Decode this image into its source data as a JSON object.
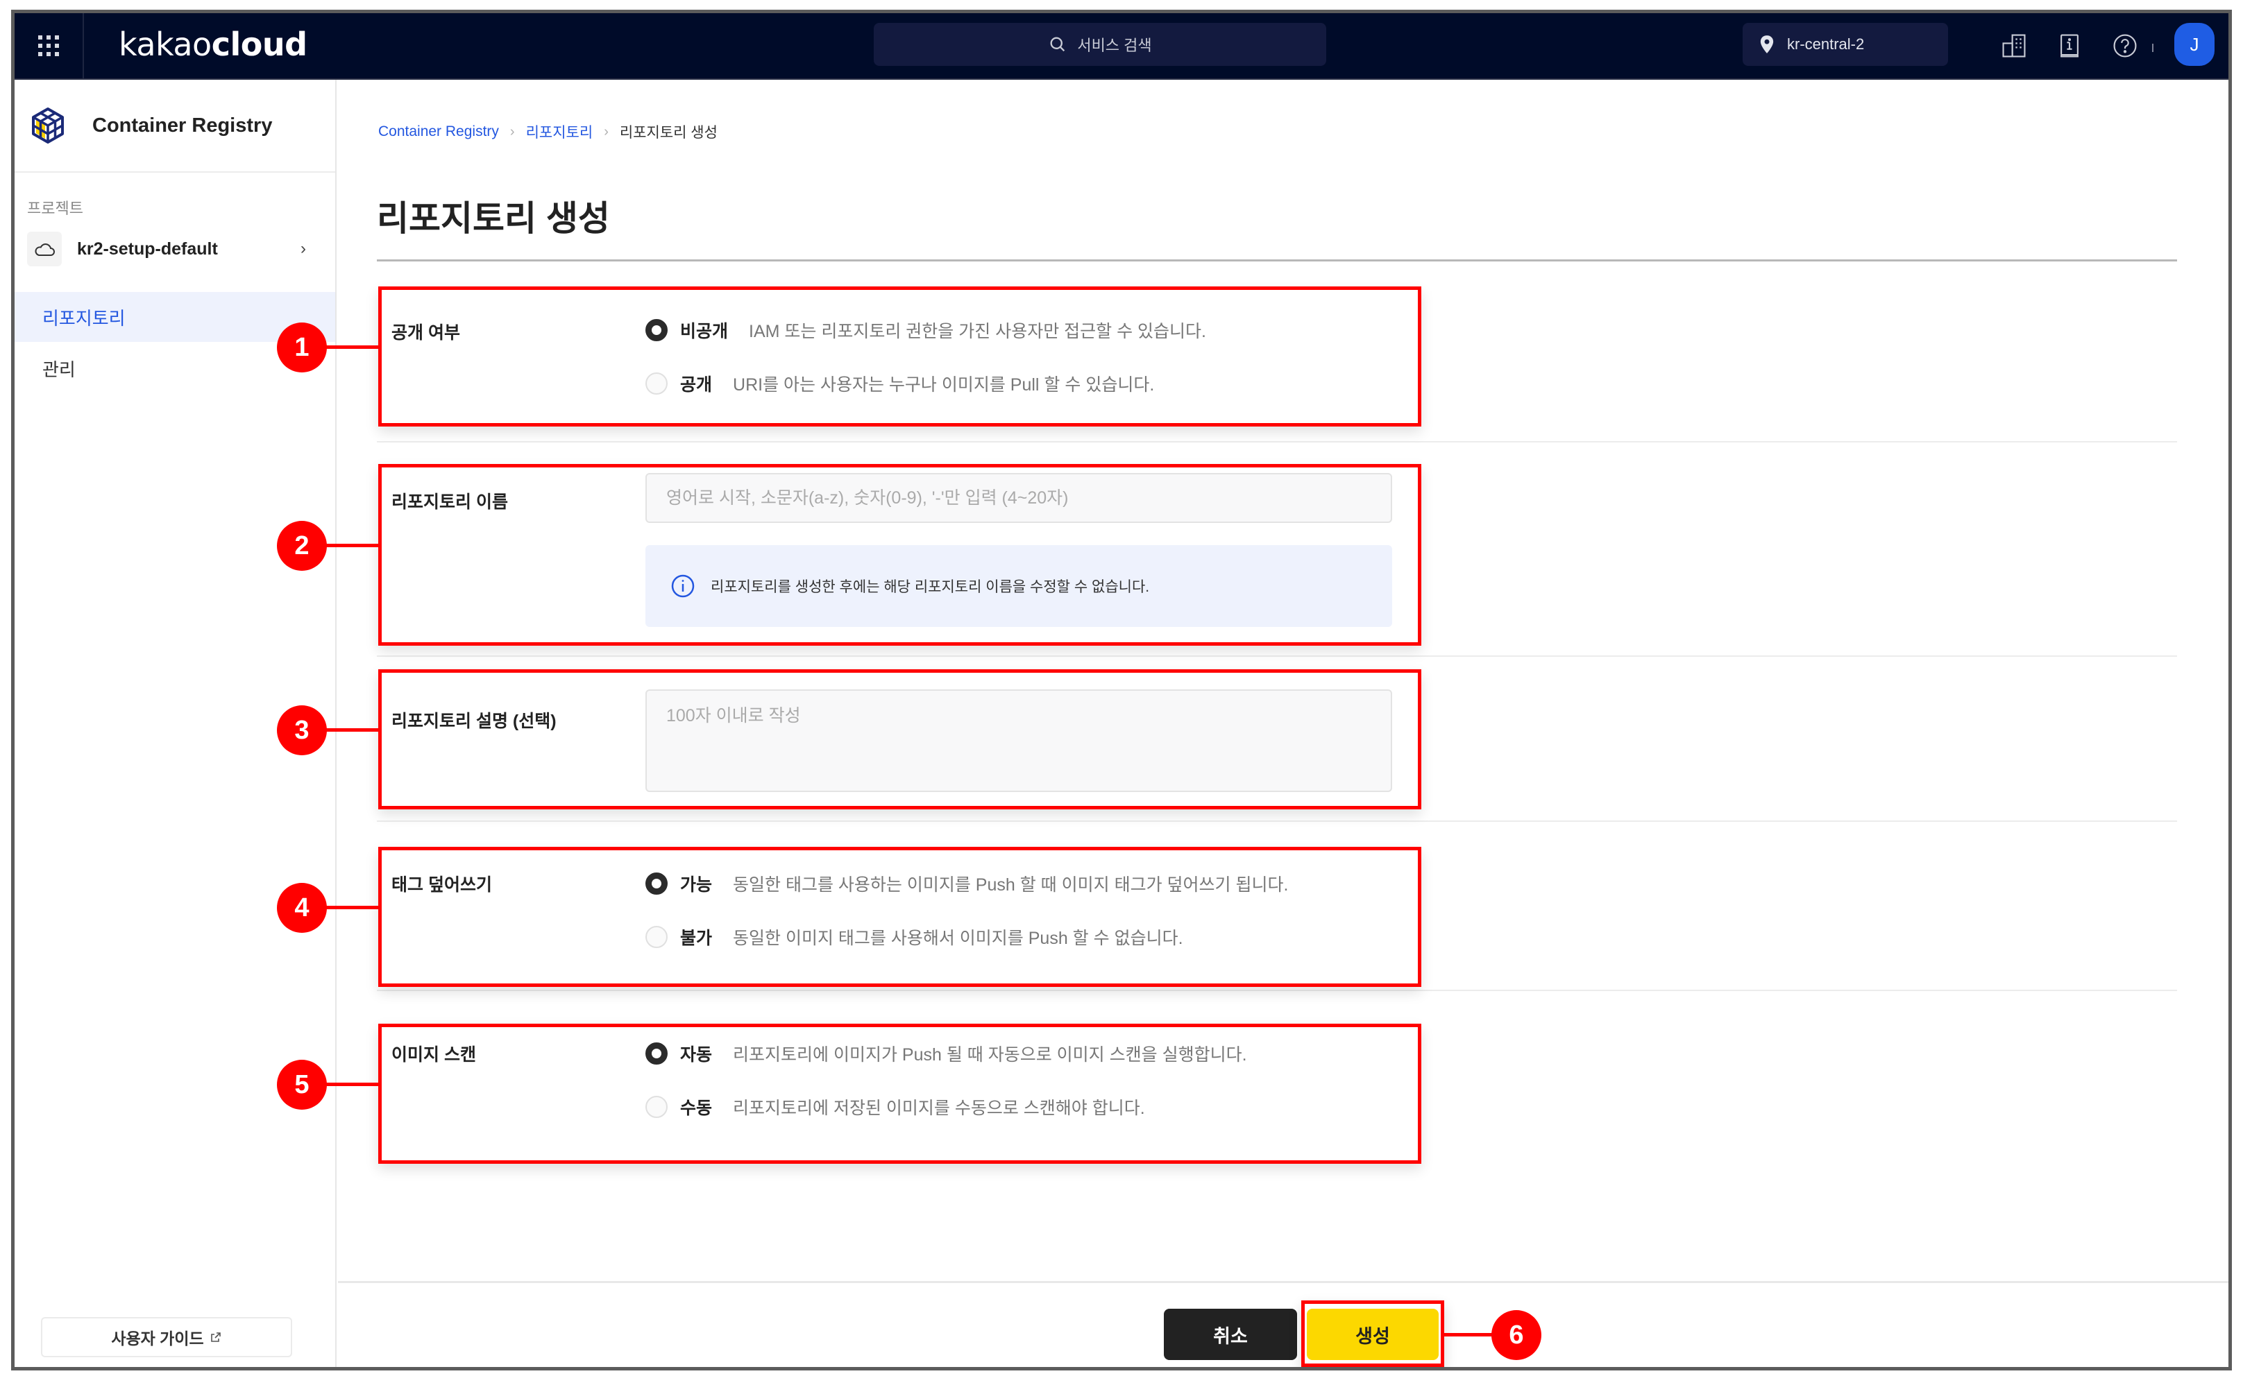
{
  "topnav": {
    "logo_light": "kakao",
    "logo_bold": "cloud",
    "search_placeholder": "서비스 검색",
    "region": "kr-central-2",
    "avatar_initial": "J",
    "icons": [
      "apps-grid-icon",
      "search-icon",
      "location-pin-icon",
      "organization-building-icon",
      "docs-book-icon",
      "help-circle-icon"
    ]
  },
  "sidebar": {
    "service_title": "Container Registry",
    "project_section_label": "프로젝트",
    "project_name": "kr2-setup-default",
    "items": [
      {
        "label": "리포지토리",
        "active": true
      },
      {
        "label": "관리",
        "active": false
      }
    ],
    "guide_button": "사용자 가이드"
  },
  "breadcrumb": [
    {
      "label": "Container Registry",
      "link": true
    },
    {
      "label": "리포지토리",
      "link": true
    },
    {
      "label": "리포지토리 생성",
      "link": false
    }
  ],
  "page_title": "리포지토리 생성",
  "form": {
    "visibility": {
      "label": "공개 여부",
      "options": [
        {
          "label": "비공개",
          "description": "IAM 또는 리포지토리 권한을 가진 사용자만 접근할 수 있습니다.",
          "checked": true
        },
        {
          "label": "공개",
          "description": "URI를 아는 사용자는 누구나 이미지를 Pull 할 수 있습니다.",
          "checked": false
        }
      ]
    },
    "name": {
      "label": "리포지토리 이름",
      "value": "",
      "placeholder": "영어로 시작, 소문자(a-z), 숫자(0-9), '-'만 입력 (4~20자)",
      "info": "리포지토리를 생성한 후에는 해당 리포지토리 이름을 수정할 수 없습니다."
    },
    "description": {
      "label": "리포지토리 설명 (선택)",
      "value": "",
      "placeholder": "100자 이내로 작성"
    },
    "tag_overwrite": {
      "label": "태그 덮어쓰기",
      "options": [
        {
          "label": "가능",
          "description": "동일한 태그를 사용하는 이미지를 Push 할 때 이미지 태그가 덮어쓰기 됩니다.",
          "checked": true
        },
        {
          "label": "불가",
          "description": "동일한 이미지 태그를 사용해서 이미지를 Push 할 수 없습니다.",
          "checked": false
        }
      ]
    },
    "image_scan": {
      "label": "이미지 스캔",
      "options": [
        {
          "label": "자동",
          "description": "리포지토리에 이미지가 Push 될 때 자동으로 이미지 스캔을 실행합니다.",
          "checked": true
        },
        {
          "label": "수동",
          "description": "리포지토리에 저장된 이미지를 수동으로 스캔해야 합니다.",
          "checked": false
        }
      ]
    }
  },
  "footer": {
    "cancel_label": "취소",
    "create_label": "생성"
  },
  "annotations": {
    "markers": [
      "1",
      "2",
      "3",
      "4",
      "5",
      "6"
    ],
    "color": "#ff0000"
  },
  "colors": {
    "nav_bg": "#000b29",
    "accent_blue": "#2357e0",
    "primary_yellow": "#fcd800",
    "avatar_blue": "#1f5de4"
  }
}
